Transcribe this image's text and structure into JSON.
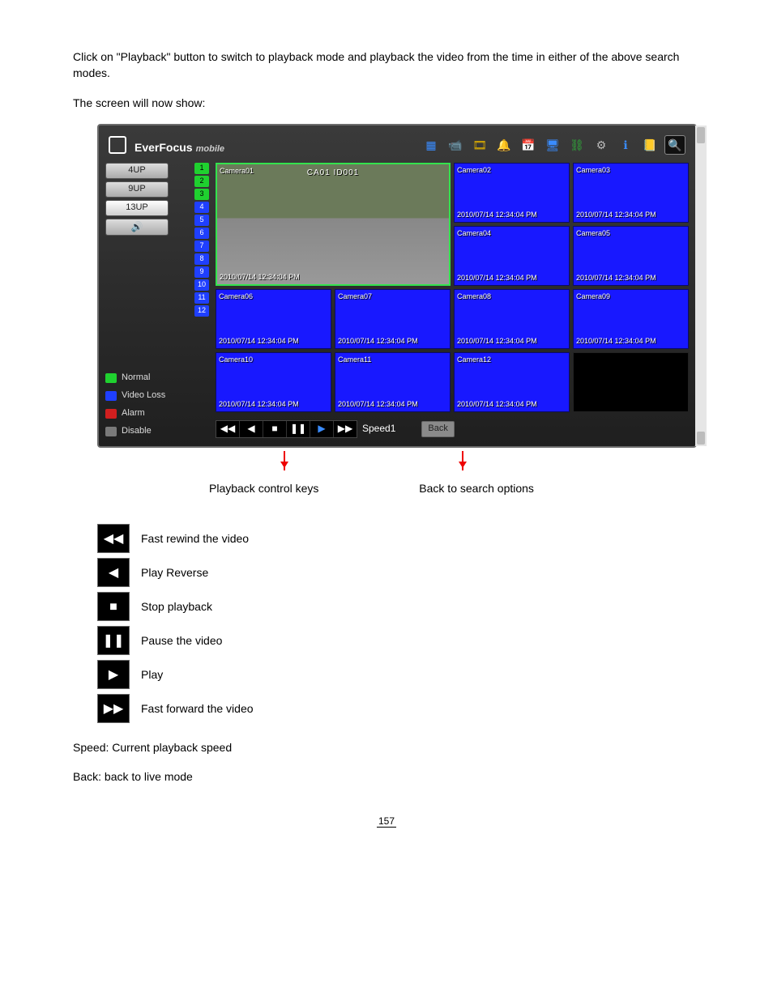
{
  "text": {
    "intro1": "Click on \"Playback\" button to switch to playback mode and playback the video from the time in either of the above search modes.",
    "intro2": "The screen will now show:",
    "controls_label": "Playback control keys",
    "back_label": "Back to search options",
    "speed_note": "Speed: Current playback speed",
    "back_note": "Back: back to live mode"
  },
  "brand": {
    "name": "EverFocus",
    "tag": "mobile"
  },
  "toolbar": {
    "icons": [
      {
        "name": "grid-icon",
        "glyph": "▦",
        "color": "#3a8cff"
      },
      {
        "name": "camera-icon",
        "glyph": "📹",
        "color": "#ccc"
      },
      {
        "name": "reel-icon",
        "glyph": "🎞",
        "color": "#e0b000"
      },
      {
        "name": "bell-icon",
        "glyph": "🔔",
        "color": "#e0b000"
      },
      {
        "name": "calendar-icon",
        "glyph": "📅",
        "color": "#e06a4a"
      },
      {
        "name": "monitor-icon",
        "glyph": "🖥",
        "color": "#3a8cff"
      },
      {
        "name": "network-icon",
        "glyph": "⛓",
        "color": "#2fae3a"
      },
      {
        "name": "gear-icon",
        "glyph": "⚙",
        "color": "#bbb"
      },
      {
        "name": "info-icon",
        "glyph": "ℹ",
        "color": "#3a8cff"
      },
      {
        "name": "log-icon",
        "glyph": "📒",
        "color": "#d0a040"
      }
    ],
    "search_glyph": "🔍"
  },
  "sidebar": {
    "buttons": [
      {
        "label": "4UP",
        "name": "layout-4up",
        "active": false
      },
      {
        "label": "9UP",
        "name": "layout-9up",
        "active": false
      },
      {
        "label": "13UP",
        "name": "layout-13up",
        "active": true
      },
      {
        "label": "🔊",
        "name": "audio-toggle",
        "active": false
      }
    ],
    "channels": [
      {
        "n": "1",
        "cls": "green"
      },
      {
        "n": "2",
        "cls": "green"
      },
      {
        "n": "3",
        "cls": "green"
      },
      {
        "n": "4",
        "cls": "blue"
      },
      {
        "n": "5",
        "cls": "blue"
      },
      {
        "n": "6",
        "cls": "blue"
      },
      {
        "n": "7",
        "cls": "blue"
      },
      {
        "n": "8",
        "cls": "blue"
      },
      {
        "n": "9",
        "cls": "blue"
      },
      {
        "n": "10",
        "cls": "blue"
      },
      {
        "n": "11",
        "cls": "blue"
      },
      {
        "n": "12",
        "cls": "blue"
      }
    ],
    "legend": [
      {
        "label": "Normal",
        "cls": "lg-normal"
      },
      {
        "label": "Video Loss",
        "cls": "lg-video"
      },
      {
        "label": "Alarm",
        "cls": "lg-alarm"
      },
      {
        "label": "Disable",
        "cls": "lg-disable"
      }
    ]
  },
  "grid": {
    "timestamp": "2010/07/14  12:34:04 PM",
    "big": {
      "name": "Camera01",
      "overlay": "CA01 ID001"
    },
    "tiles": [
      {
        "name": "Camera02"
      },
      {
        "name": "Camera03"
      },
      {
        "name": "Camera04"
      },
      {
        "name": "Camera05"
      },
      {
        "name": "Camera06"
      },
      {
        "name": "Camera07"
      },
      {
        "name": "Camera08"
      },
      {
        "name": "Camera09"
      },
      {
        "name": "Camera10"
      },
      {
        "name": "Camera11"
      },
      {
        "name": "Camera12"
      },
      {
        "name": "",
        "black": true
      }
    ]
  },
  "controls": {
    "buttons": [
      {
        "name": "fast-rewind",
        "glyph": "◀◀"
      },
      {
        "name": "step-back",
        "glyph": "◀"
      },
      {
        "name": "stop",
        "glyph": "■"
      },
      {
        "name": "pause",
        "glyph": "❚❚"
      },
      {
        "name": "play",
        "glyph": "▶",
        "cls": "play"
      },
      {
        "name": "fast-forward",
        "glyph": "▶▶"
      }
    ],
    "speed_label": "Speed1",
    "back_label": "Back"
  },
  "playback_legend": [
    {
      "name": "fast-rewind",
      "glyph": "◀◀",
      "text": "Fast rewind the video"
    },
    {
      "name": "step-back",
      "glyph": "◀",
      "text": "Play Reverse"
    },
    {
      "name": "stop",
      "glyph": "■",
      "text": "Stop playback"
    },
    {
      "name": "pause",
      "glyph": "❚❚",
      "text": "Pause the video"
    },
    {
      "name": "play",
      "glyph": "▶",
      "text": "Play"
    },
    {
      "name": "fast-forward",
      "glyph": "▶▶",
      "text": "Fast forward the video"
    }
  ],
  "page_number": "157"
}
